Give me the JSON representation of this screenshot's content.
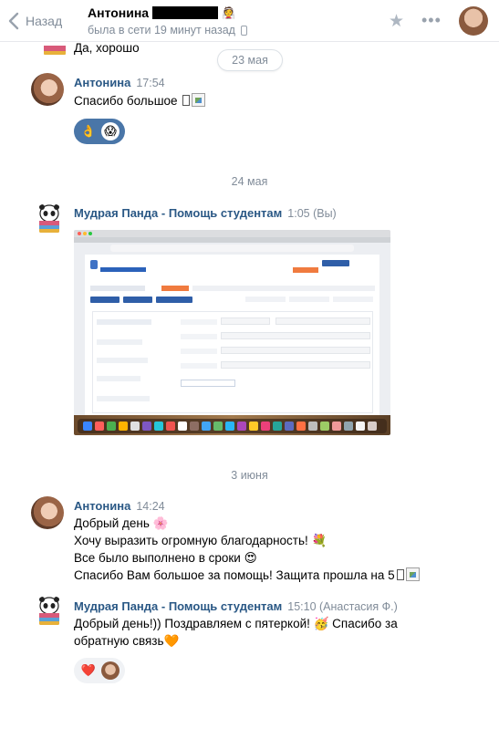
{
  "header": {
    "back_label": "Назад",
    "contact_name": "Антонина",
    "name_emoji": "👰",
    "status": "была в сети 19 минут назад"
  },
  "messages": {
    "top_fragment": "Да, хорошо",
    "date_1": "23 мая",
    "m1": {
      "author": "Антонина",
      "time": "17:54",
      "text": "Спасибо большое "
    },
    "m1_reactions": [
      "👌",
      "😱"
    ],
    "date_2": "24 мая",
    "m2": {
      "author": "Мудрая Панда - Помощь студентам",
      "time": "1:05 (Вы)"
    },
    "date_3": "3 июня",
    "m3": {
      "author": "Антонина",
      "time": "14:24",
      "lines": [
        "Добрый день 🌸",
        "Хочу выразить огромную благодарность! 💐",
        "Все было выполнено в сроки 😍",
        "Спасибо Вам большое за помощь! Защита прошла на 5"
      ]
    },
    "m4": {
      "author": "Мудрая Панда - Помощь студентам",
      "time": "15:10 (Анастасия Ф.)",
      "lines": [
        "Добрый день!)) Поздравляем с пятеркой! 🥳 Спасибо за",
        "обратную связь🧡"
      ]
    },
    "m4_reactions": [
      "❤️"
    ]
  },
  "icons": {
    "back": "chevron-left-icon",
    "favorite": "star-icon",
    "more": "more-dots-icon",
    "device": "mobile-phone-icon"
  },
  "colors": {
    "author_link": "#2a5885",
    "meta_gray": "#818c99",
    "reaction_blue": "#4a76a8"
  }
}
